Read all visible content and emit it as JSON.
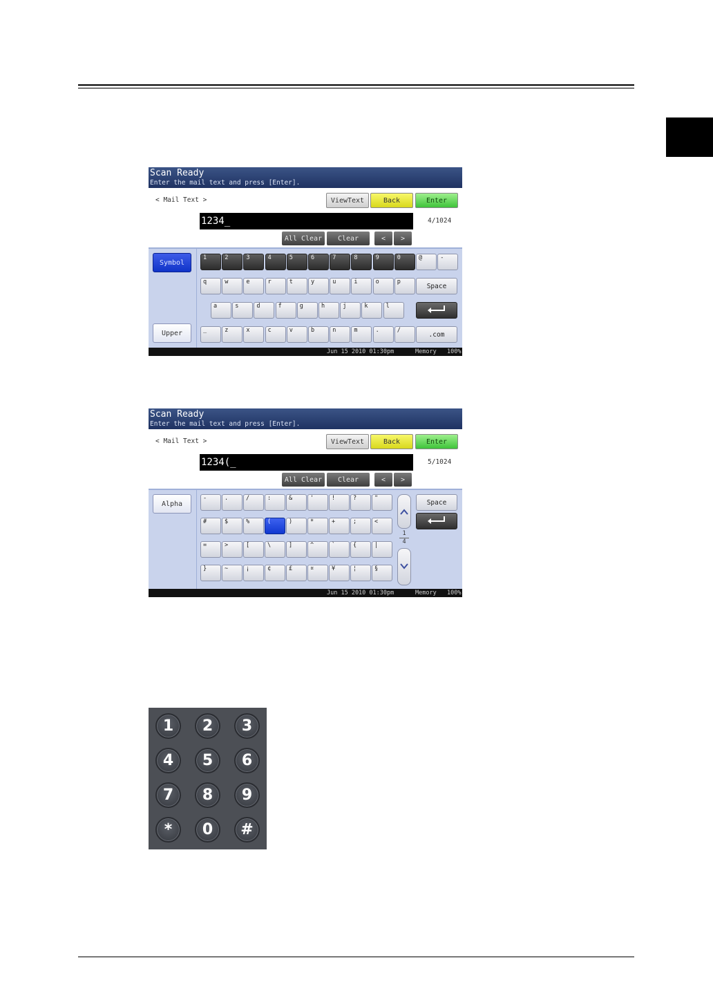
{
  "screen1": {
    "title": "Scan Ready",
    "subtitle": "Enter the mail text and press [Enter].",
    "label": "< Mail Text >",
    "viewtext": "ViewText",
    "back": "Back",
    "enter": "Enter",
    "field": "1234_",
    "count": "4/1024",
    "allclear": "All Clear",
    "clear": "Clear",
    "left": "<",
    "right": ">",
    "mode_top": "Symbol",
    "mode_bottom": "Upper",
    "row1": [
      "1",
      "2",
      "3",
      "4",
      "5",
      "6",
      "7",
      "8",
      "9",
      "0",
      "@",
      "-"
    ],
    "row2": [
      "q",
      "w",
      "e",
      "r",
      "t",
      "y",
      "u",
      "i",
      "o",
      "p"
    ],
    "row3": [
      "a",
      "s",
      "d",
      "f",
      "g",
      "h",
      "j",
      "k",
      "l"
    ],
    "row4": [
      "_",
      "z",
      "x",
      "c",
      "v",
      "b",
      "n",
      "m",
      ".",
      "/"
    ],
    "space": "Space",
    "dotcom": ".com",
    "date": "Jun 15 2010 01:30pm",
    "memory": "Memory",
    "percent": "100%"
  },
  "screen2": {
    "title": "Scan Ready",
    "subtitle": "Enter the mail text and press [Enter].",
    "label": "< Mail Text >",
    "viewtext": "ViewText",
    "back": "Back",
    "enter": "Enter",
    "field": "1234(_",
    "count": "5/1024",
    "allclear": "All Clear",
    "clear": "Clear",
    "left": "<",
    "right": ">",
    "mode_top": "Alpha",
    "row1": [
      "-",
      ".",
      "/",
      ":",
      "&",
      "'",
      "!",
      "?",
      "\""
    ],
    "row2": [
      "#",
      "$",
      "%",
      "(",
      ")",
      "*",
      "+",
      ";",
      "<"
    ],
    "row3": [
      "=",
      ">",
      "[",
      "\\",
      "]",
      "^",
      "`",
      "{",
      "|"
    ],
    "row4": [
      "}",
      "~",
      "¡",
      "¢",
      "£",
      "¤",
      "¥",
      "¦",
      "§"
    ],
    "page": "1",
    "pages": "4",
    "space": "Space",
    "date": "Jun 15 2010 01:30pm",
    "memory": "Memory",
    "percent": "100%"
  },
  "keypad": [
    "1",
    "2",
    "3",
    "4",
    "5",
    "6",
    "7",
    "8",
    "9",
    "*",
    "0",
    "#"
  ]
}
